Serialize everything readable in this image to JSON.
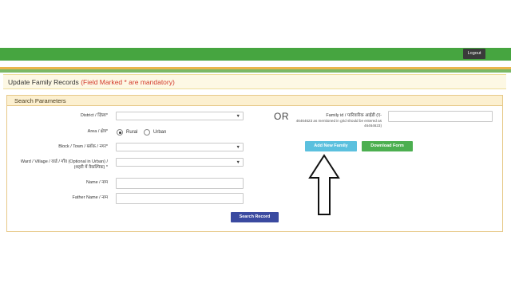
{
  "header": {
    "logout_label": "Logout",
    "colors": {
      "topbar": "#46a540",
      "stripe_orange": "#eab64d",
      "stripe_green": "#7bb865"
    }
  },
  "page": {
    "title": "Update Family Records",
    "mandatory_note": "(Field Marked * are mandatory)"
  },
  "search_panel": {
    "title": "Search Parameters",
    "district_label": "District / ज़िला*",
    "district_value": "",
    "area_label": "Area / क्षेत्र*",
    "area_options": {
      "rural": "Rural",
      "urban": "Urban"
    },
    "area_selected": "Rural",
    "block_label": "Block / Town / ब्लॉक / नगर*",
    "block_value": "",
    "ward_label": "Ward / Village / वार्ड / गाँव (Optional in Urban) / (शहरी में वैकल्पिक) *",
    "ward_value": "",
    "name_label": "Name / नाम",
    "name_value": "",
    "father_name_label": "Father Name / नाम",
    "father_name_value": "",
    "search_button": "Search Record",
    "or_text": "OR",
    "family_id_label": "Family id / पारिवारिक आईडी (ए-",
    "family_id_note": "46464623 as mentioned in grid should be entered as 46464623)",
    "family_id_value": "",
    "add_family_button": "Add New Family",
    "download_form_button": "Download Form",
    "colors": {
      "add_button": "#5bc0de",
      "download_button": "#4caf50",
      "search_button": "#3a4aa0"
    }
  },
  "annotation": {
    "icon": "up-arrow-icon"
  }
}
